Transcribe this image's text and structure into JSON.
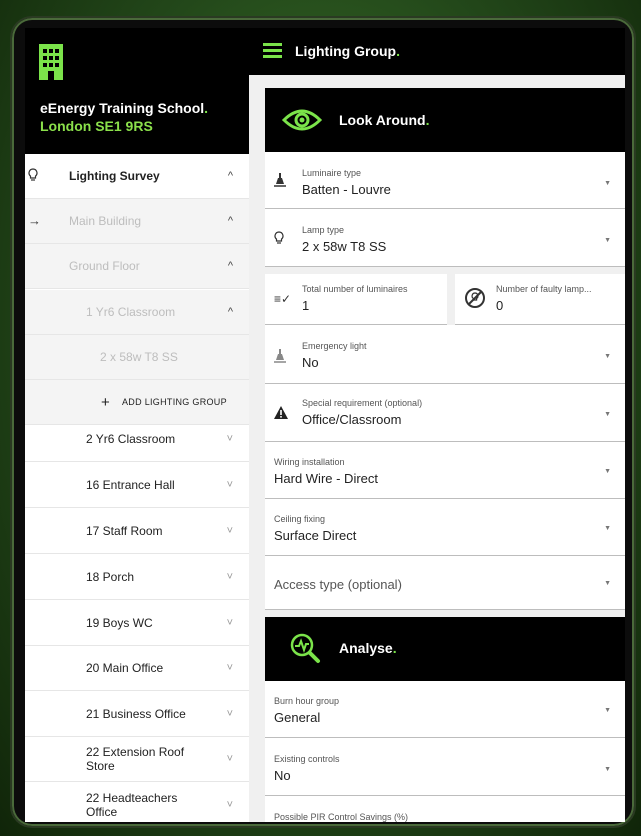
{
  "sidebar": {
    "org_name": "eEnergy Training School",
    "org_dot": ".",
    "address": "London SE1 9RS",
    "items": [
      {
        "label": "Lighting Survey",
        "chevron": "^"
      },
      {
        "label": "Main Building",
        "chevron": "^"
      },
      {
        "label": "Ground Floor",
        "chevron": "^"
      },
      {
        "label": "1 Yr6 Classroom",
        "chevron": "^"
      },
      {
        "label": "2 x 58w T8 SS"
      },
      {
        "label": "ADD LIGHTING GROUP",
        "prefix": "+"
      },
      {
        "label": "2 Yr6 Classroom",
        "chevron": "˅"
      },
      {
        "label": "16 Entrance Hall",
        "chevron": "˅"
      },
      {
        "label": "17 Staff Room",
        "chevron": "˅"
      },
      {
        "label": "18 Porch",
        "chevron": "˅"
      },
      {
        "label": "19 Boys WC",
        "chevron": "˅"
      },
      {
        "label": "20 Main Office",
        "chevron": "˅"
      },
      {
        "label": "21 Business Office",
        "chevron": "˅"
      },
      {
        "label": "22 Extension Roof Store",
        "chevron": "˅"
      },
      {
        "label": "22 Headteachers Office",
        "chevron": "˅"
      }
    ]
  },
  "header": {
    "title": "Lighting Group",
    "dot": "."
  },
  "look_around": {
    "title": "Look Around",
    "dot": ".",
    "fields": {
      "luminaire_type": {
        "label": "Luminaire type",
        "value": "Batten - Louvre"
      },
      "lamp_type": {
        "label": "Lamp type",
        "value": "2 x 58w T8 SS"
      },
      "total_luminaires": {
        "label": "Total number of luminaires",
        "value": "1"
      },
      "faulty_lamps": {
        "label": "Number of faulty lamp...",
        "value": "0"
      },
      "emergency_light": {
        "label": "Emergency light",
        "value": "No"
      },
      "special_requirement": {
        "label": "Special requirement (optional)",
        "value": "Office/Classroom"
      },
      "wiring_installation": {
        "label": "Wiring installation",
        "value": "Hard Wire - Direct"
      },
      "ceiling_fixing": {
        "label": "Ceiling fixing",
        "value": "Surface Direct"
      },
      "access_type": {
        "placeholder": "Access type (optional)"
      }
    }
  },
  "analyse": {
    "title": "Analyse",
    "dot": ".",
    "fields": {
      "burn_hour_group": {
        "label": "Burn hour group",
        "value": "General"
      },
      "existing_controls": {
        "label": "Existing controls",
        "value": "No"
      },
      "pir_savings": {
        "label": "Possible PIR Control Savings (%)"
      }
    }
  },
  "colors": {
    "accent": "#7be34a",
    "header_bg": "#000000"
  }
}
